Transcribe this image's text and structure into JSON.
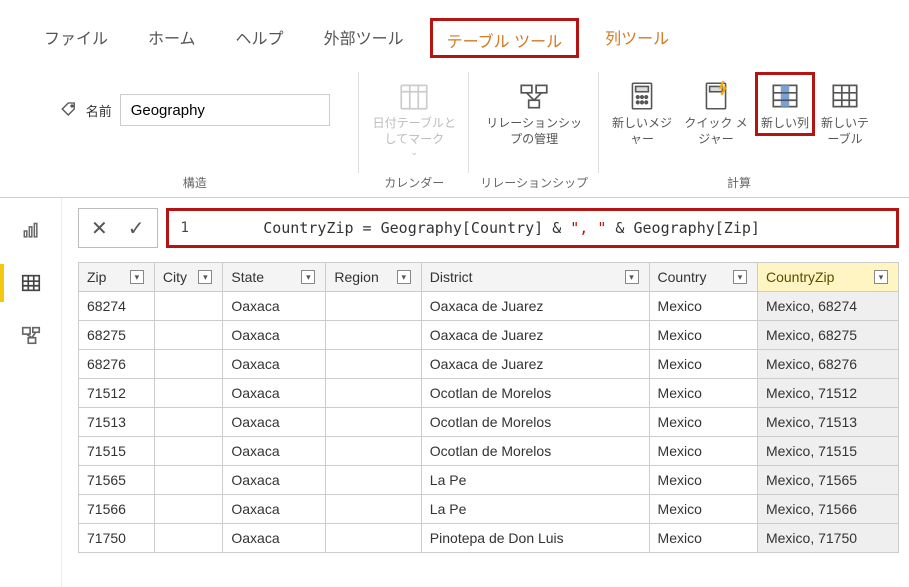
{
  "tabs": {
    "file": "ファイル",
    "home": "ホーム",
    "help": "ヘルプ",
    "external": "外部ツール",
    "table_tools": "テーブル ツール",
    "column_tools": "列ツール"
  },
  "ribbon": {
    "name_label": "名前",
    "name_value": "Geography",
    "group_structure": "構造",
    "group_calendar": "カレンダー",
    "group_relationship": "リレーションシップ",
    "group_calc": "計算",
    "btn_date_table": "日付テーブルとしてマーク",
    "btn_manage_rel": "リレーションシップの管理",
    "btn_new_measure": "新しいメジャー",
    "btn_quick_measure": "クイック メジャー",
    "btn_new_column": "新しい列",
    "btn_new_table": "新しいテーブル"
  },
  "formula": {
    "line_no": "1",
    "lhs": "CountryZip",
    "eq": " = ",
    "ref1": "Geography[Country]",
    "amp1": " & ",
    "str": "\", \"",
    "amp2": " & ",
    "ref2": "Geography[Zip]"
  },
  "columns": {
    "zip": "Zip",
    "city": "City",
    "state": "State",
    "region": "Region",
    "district": "District",
    "country": "Country",
    "countryzip": "CountryZip"
  },
  "rows": [
    {
      "zip": "68274",
      "city": "",
      "state": "Oaxaca",
      "region": "",
      "district": "Oaxaca de Juarez",
      "country": "Mexico",
      "countryzip": "Mexico, 68274"
    },
    {
      "zip": "68275",
      "city": "",
      "state": "Oaxaca",
      "region": "",
      "district": "Oaxaca de Juarez",
      "country": "Mexico",
      "countryzip": "Mexico, 68275"
    },
    {
      "zip": "68276",
      "city": "",
      "state": "Oaxaca",
      "region": "",
      "district": "Oaxaca de Juarez",
      "country": "Mexico",
      "countryzip": "Mexico, 68276"
    },
    {
      "zip": "71512",
      "city": "",
      "state": "Oaxaca",
      "region": "",
      "district": "Ocotlan de Morelos",
      "country": "Mexico",
      "countryzip": "Mexico, 71512"
    },
    {
      "zip": "71513",
      "city": "",
      "state": "Oaxaca",
      "region": "",
      "district": "Ocotlan de Morelos",
      "country": "Mexico",
      "countryzip": "Mexico, 71513"
    },
    {
      "zip": "71515",
      "city": "",
      "state": "Oaxaca",
      "region": "",
      "district": "Ocotlan de Morelos",
      "country": "Mexico",
      "countryzip": "Mexico, 71515"
    },
    {
      "zip": "71565",
      "city": "",
      "state": "Oaxaca",
      "region": "",
      "district": "La Pe",
      "country": "Mexico",
      "countryzip": "Mexico, 71565"
    },
    {
      "zip": "71566",
      "city": "",
      "state": "Oaxaca",
      "region": "",
      "district": "La Pe",
      "country": "Mexico",
      "countryzip": "Mexico, 71566"
    },
    {
      "zip": "71750",
      "city": "",
      "state": "Oaxaca",
      "region": "",
      "district": "Pinotepa de Don Luis",
      "country": "Mexico",
      "countryzip": "Mexico, 71750"
    }
  ]
}
